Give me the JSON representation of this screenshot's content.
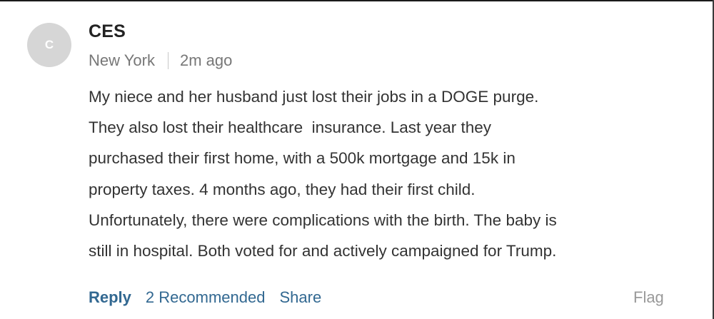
{
  "comment": {
    "avatar_initial": "C",
    "author": "CES",
    "location": "New York",
    "time_ago": "2m ago",
    "body_lines": [
      "My niece and her husband just lost their jobs in a DOGE purge.",
      "They also lost their healthcare  insurance. Last year they",
      "purchased their first home, with a 500k mortgage and 15k in",
      "property taxes. 4 months ago, they had their first child.",
      "Unfortunately, there were complications with the birth. The baby is",
      "still in hospital. Both voted for and actively campaigned for Trump."
    ],
    "actions": {
      "reply": "Reply",
      "recommended": "2 Recommended",
      "share": "Share",
      "flag": "Flag"
    }
  },
  "colors": {
    "link": "#326891",
    "author": "#222222",
    "meta": "#777777",
    "body": "#333333",
    "flag": "#999999",
    "avatar_bg": "#d6d6d6"
  }
}
